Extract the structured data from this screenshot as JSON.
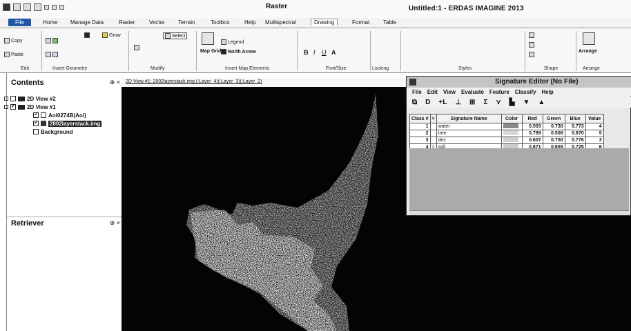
{
  "window": {
    "title": "Untitled:1 - ERDAS IMAGINE 2013",
    "contextual_tab": "Raster"
  },
  "ribbon_tabs": [
    {
      "label": "File"
    },
    {
      "label": "Home"
    },
    {
      "label": "Manage Data"
    },
    {
      "label": "Raster"
    },
    {
      "label": "Vector"
    },
    {
      "label": "Terrain"
    },
    {
      "label": "Toolbox"
    },
    {
      "label": "Help"
    },
    {
      "label": "Multispectral"
    },
    {
      "label": "Drawing"
    },
    {
      "label": "Format"
    },
    {
      "label": "Table"
    }
  ],
  "ribbon": {
    "copy": "Copy",
    "paste": "Paste",
    "grow": "Grow",
    "select": "Select",
    "legend": "Legend",
    "north_arrow": "North Arrow",
    "map_grid": "Map Grid",
    "arrange": "Arrange",
    "groups": {
      "edit": "Edit",
      "insert_geometry": "Insert Geometry",
      "modify": "Modify",
      "insert_map_elements": "Insert Map Elements",
      "font_size": "Font/Size",
      "locking": "Locking",
      "styles": "Styles",
      "shape": "Shape",
      "arrange": "Arrange"
    }
  },
  "contents_panel": {
    "title": "Contents",
    "pin": "⊕ ×",
    "items": [
      {
        "label": "2D View #2"
      },
      {
        "label": "2D View #1"
      },
      {
        "label": "Aoi0274B(Aoi)"
      },
      {
        "label": "2002layerstack.img"
      },
      {
        "label": "Background"
      }
    ]
  },
  "retriever_panel": {
    "title": "Retriever",
    "pin": "⊕ ×"
  },
  "view": {
    "title": "2D View #1: 2002layerstack.img (:Layer_4)(:Layer_3)(:Layer_2)"
  },
  "signature_editor": {
    "title": "Signature Editor (No File)",
    "menu": [
      "File",
      "Edit",
      "View",
      "Evaluate",
      "Feature",
      "Classify",
      "Help"
    ],
    "toolbar": [
      "⧉",
      "D",
      "+L",
      "⊥",
      "⊞",
      "Σ",
      "⋎",
      "▙",
      "▼",
      "▲"
    ],
    "columns": [
      "Class #",
      ">",
      "Signature Name",
      "Color",
      "Red",
      "Green",
      "Blue",
      "Value"
    ],
    "rows": [
      {
        "id": "1",
        "marker": "",
        "name": "water",
        "color": "#8a8a8a",
        "red": "0.503",
        "green": "0.730",
        "blue": "0.773",
        "value": "4"
      },
      {
        "id": "2",
        "marker": "",
        "name": "tree",
        "color": "#d8d8d8",
        "red": "0.789",
        "green": "0.508",
        "blue": "0.870",
        "value": "5"
      },
      {
        "id": "3",
        "marker": "",
        "name": "dez",
        "color": "#d0d0d0",
        "red": "0.607",
        "green": "0.750",
        "blue": "0.776",
        "value": "3"
      },
      {
        "id": "4",
        "marker": ">",
        "name": "soil",
        "color": "#cccccc",
        "red": "0.871",
        "green": "0.655",
        "blue": "0.725",
        "value": "6"
      }
    ]
  }
}
